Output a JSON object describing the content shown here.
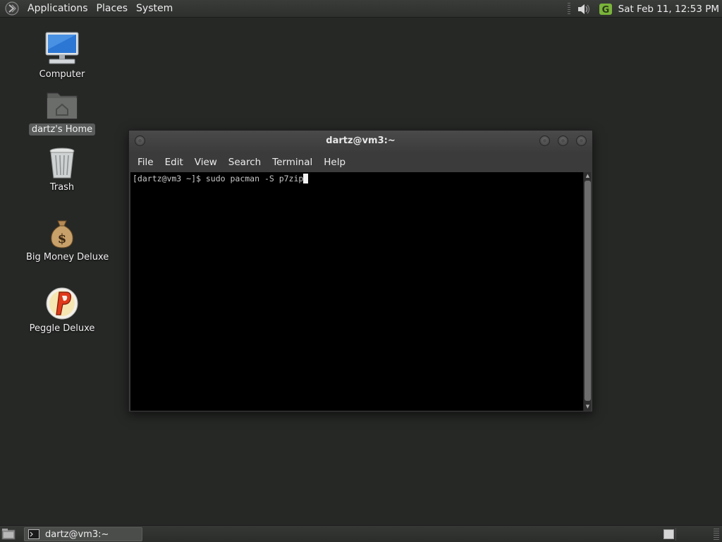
{
  "top_panel": {
    "menus": [
      "Applications",
      "Places",
      "System"
    ],
    "clock": "Sat Feb 11, 12:53 PM",
    "icons": [
      "distro-logo-icon",
      "volume-icon",
      "update-icon"
    ]
  },
  "desktop_icons": [
    {
      "label": "Computer",
      "icon": "computer-icon"
    },
    {
      "label": "dartz's Home",
      "icon": "home-folder-icon",
      "selected": true
    },
    {
      "label": "Trash",
      "icon": "trash-icon"
    },
    {
      "label": "Big Money Deluxe",
      "icon": "money-bag-icon"
    },
    {
      "label": "Peggle Deluxe",
      "icon": "peggle-icon"
    }
  ],
  "terminal": {
    "title": "dartz@vm3:~",
    "menu": [
      "File",
      "Edit",
      "View",
      "Search",
      "Terminal",
      "Help"
    ],
    "prompt": "[dartz@vm3 ~]$ ",
    "command": "sudo pacman -S p7zip"
  },
  "taskbar": {
    "task_label": "dartz@vm3:~"
  },
  "colors": {
    "desktop_bg": "#262826",
    "panel_bg": "#333533",
    "terminal_bg": "#000000",
    "update_icon_green": "#7ab43a"
  }
}
